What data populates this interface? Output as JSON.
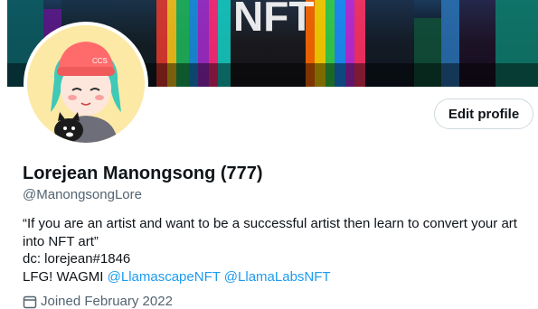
{
  "profile": {
    "name": "Lorejean Manongsong (777)",
    "handle": "@ManongsongLore",
    "edit_label": "Edit profile",
    "bio": {
      "line1": "“If you are an artist and want to be a successful artist then learn to convert your art",
      "line2": "into NFT art”",
      "line3": "dc: lorejean#1846",
      "line4_prefix": "LFG! WAGMI",
      "mention1": "@LlamascapeNFT",
      "mention2": "@LlamaLabsNFT"
    },
    "joined": "Joined February 2022"
  },
  "banner": {
    "text": "NFT",
    "icon": "nft-banner-art"
  },
  "avatar": {
    "icon": "cartoon-girl-avatar"
  },
  "colors": {
    "link": "#1d9bf0",
    "muted": "#536471",
    "text": "#0f1419",
    "border": "#cfd9de"
  }
}
